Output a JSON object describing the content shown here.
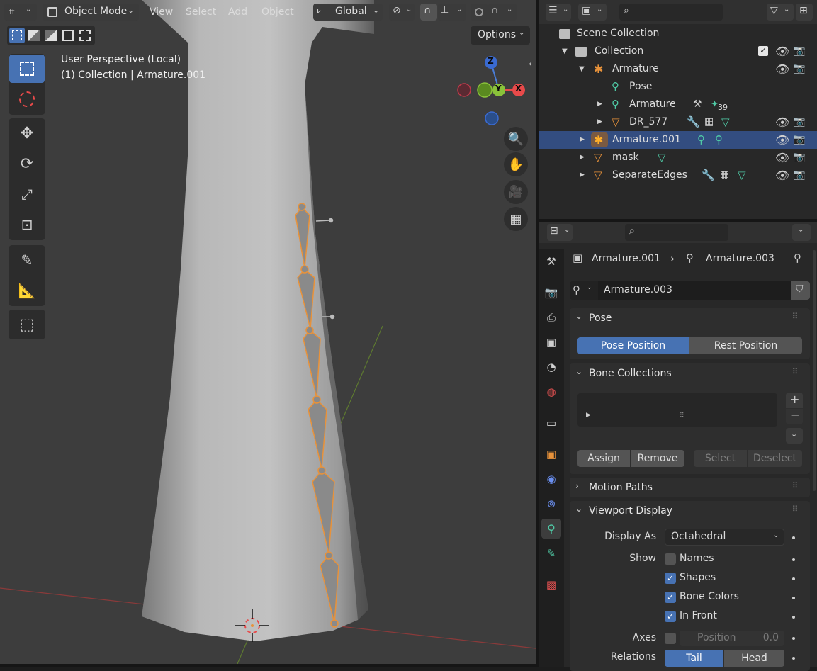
{
  "viewport": {
    "header": {
      "mode": "Object Mode",
      "menus": [
        "View",
        "Select",
        "Add",
        "Object"
      ],
      "transform_orientation": "Global",
      "options_label": "Options"
    },
    "overlay_title": "User Perspective (Local)",
    "overlay_subtitle": "(1) Collection | Armature.001",
    "gizmo": {
      "z": "Z",
      "y": "Y",
      "x": "X"
    }
  },
  "outliner": {
    "rows": [
      {
        "label": "Scene Collection"
      },
      {
        "label": "Collection"
      },
      {
        "label": "Armature"
      },
      {
        "label": "Pose"
      },
      {
        "label": "Armature",
        "badge": "39"
      },
      {
        "label": "DR_577"
      },
      {
        "label": "Armature.001"
      },
      {
        "label": "mask"
      },
      {
        "label": "SeparateEdges"
      }
    ]
  },
  "properties": {
    "breadcrumb": {
      "object": "Armature.001",
      "data": "Armature.003"
    },
    "datablock_name": "Armature.003",
    "panels": {
      "pose": {
        "title": "Pose",
        "pose_position": "Pose Position",
        "rest_position": "Rest Position"
      },
      "bone_collections": {
        "title": "Bone Collections",
        "assign": "Assign",
        "remove": "Remove",
        "select": "Select",
        "deselect": "Deselect"
      },
      "motion_paths": {
        "title": "Motion Paths"
      },
      "viewport_display": {
        "title": "Viewport Display",
        "display_as_label": "Display As",
        "display_as_value": "Octahedral",
        "show_label": "Show",
        "names": "Names",
        "shapes": "Shapes",
        "bone_colors": "Bone Colors",
        "in_front": "In Front",
        "axes_label": "Axes",
        "position_label": "Position",
        "position_value": "0.0",
        "relations_label": "Relations",
        "tail": "Tail",
        "head": "Head"
      }
    }
  },
  "colors": {
    "accent": "#4772b3",
    "selection": "#ffaf29",
    "bone": "#e8923a"
  }
}
